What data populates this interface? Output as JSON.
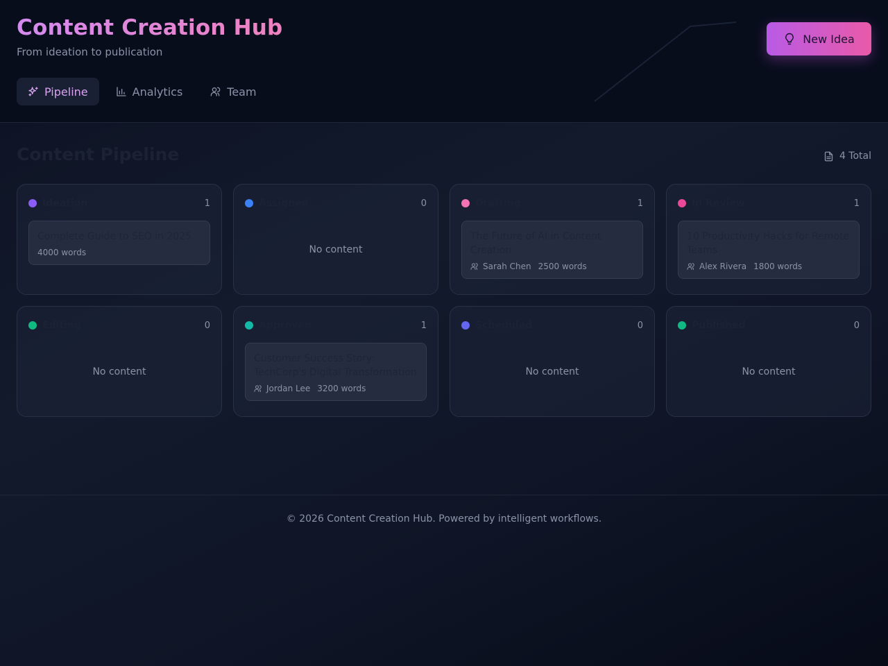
{
  "header": {
    "title": "Content Creation Hub",
    "subtitle": "From ideation to publication",
    "new_idea_label": "New Idea",
    "tabs": [
      {
        "label": "Pipeline",
        "icon": "sparkles-icon",
        "active": true
      },
      {
        "label": "Analytics",
        "icon": "bar-chart-icon",
        "active": false
      },
      {
        "label": "Team",
        "icon": "users-icon",
        "active": false
      }
    ]
  },
  "main": {
    "title": "Content Pipeline",
    "total_label": "4 Total",
    "empty_label": "No content",
    "columns": [
      {
        "name": "Ideation",
        "count": "1",
        "color": "#8b5cf6",
        "cards": [
          {
            "title": "Complete Guide to SEO in 2025",
            "author": "",
            "words": "4000 words"
          }
        ]
      },
      {
        "name": "Assigned",
        "count": "0",
        "color": "#3b82f6",
        "cards": []
      },
      {
        "name": "Drafting",
        "count": "1",
        "color": "#f472b6",
        "cards": [
          {
            "title": "The Future of AI in Content Creation",
            "author": "Sarah Chen",
            "words": "2500 words"
          }
        ]
      },
      {
        "name": "In Review",
        "count": "1",
        "color": "#ec4899",
        "cards": [
          {
            "title": "10 Productivity Hacks for Remote Teams",
            "author": "Alex Rivera",
            "words": "1800 words"
          }
        ]
      },
      {
        "name": "Editing",
        "count": "0",
        "color": "#10b981",
        "cards": []
      },
      {
        "name": "Approved",
        "count": "1",
        "color": "#14b8a6",
        "cards": [
          {
            "title": "Customer Success Story: TechCorp's Digital Transformation",
            "author": "Jordan Lee",
            "words": "3200 words"
          }
        ]
      },
      {
        "name": "Scheduled",
        "count": "0",
        "color": "#6366f1",
        "cards": []
      },
      {
        "name": "Published",
        "count": "0",
        "color": "#10b981",
        "cards": []
      }
    ]
  },
  "footer": {
    "text": "© 2026 Content Creation Hub. Powered by intelligent workflows."
  }
}
